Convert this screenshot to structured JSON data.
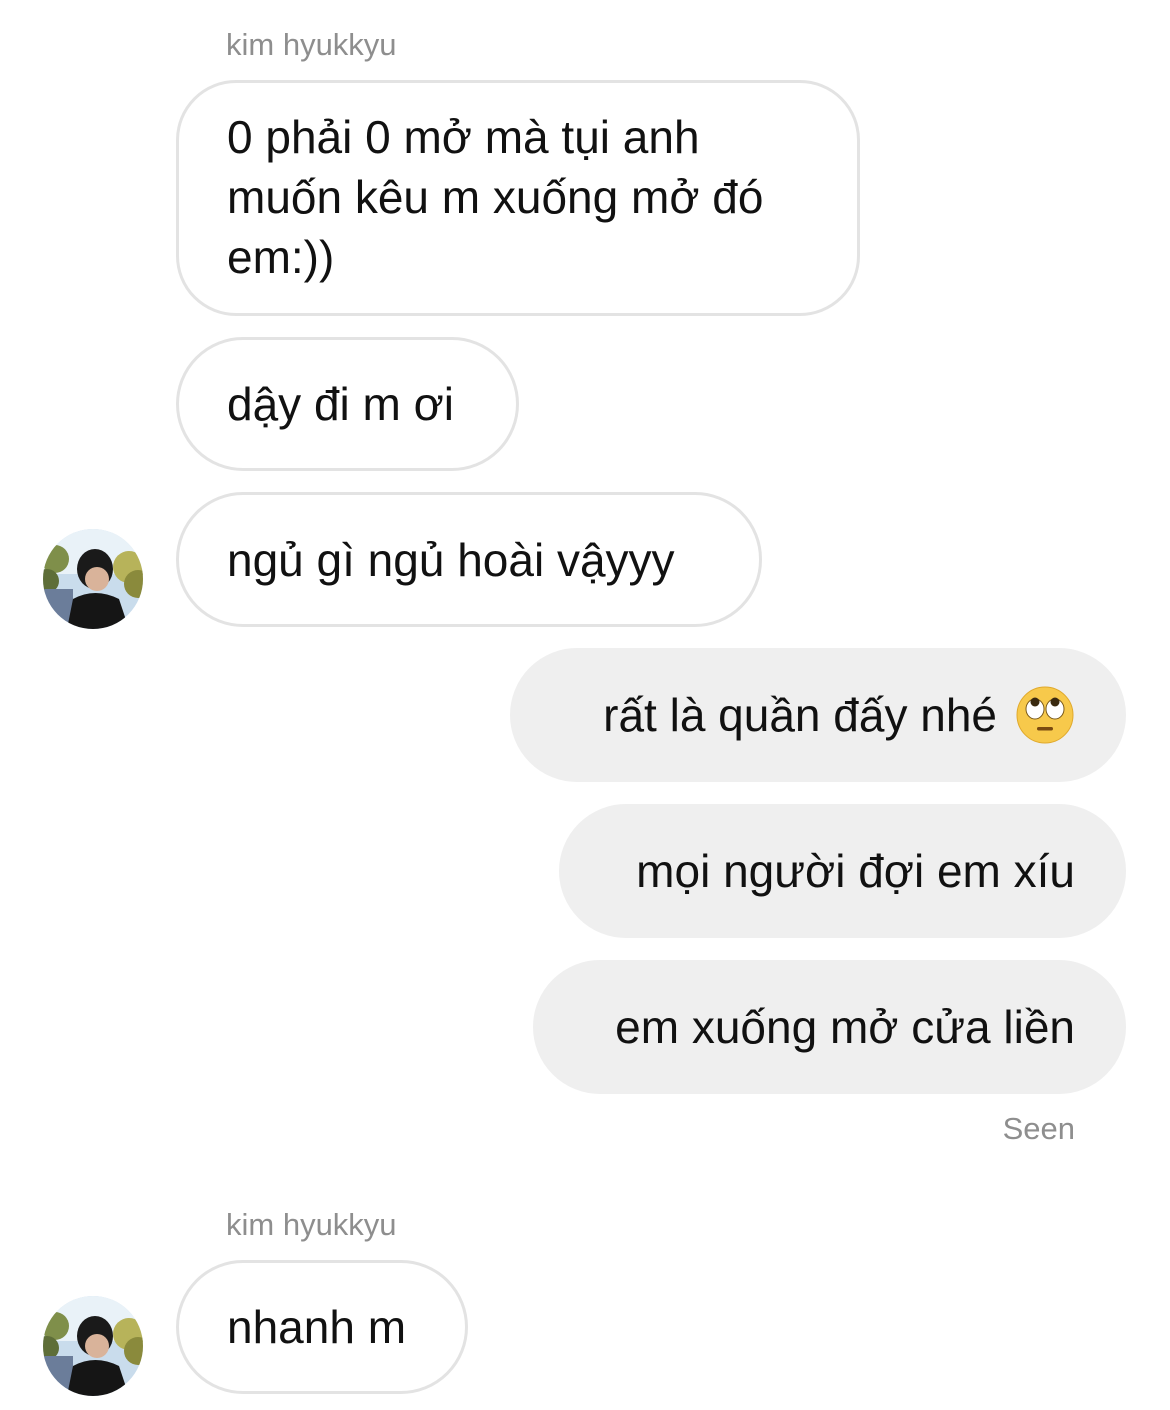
{
  "conversation": {
    "sender_name_1": "kim hyukkyu",
    "sender_name_2": "kim hyukkyu",
    "messages": [
      {
        "text_lines": [
          "0 phải 0 mở mà tụi anh",
          "muốn kêu m xuống mở đó",
          "em:))"
        ],
        "direction": "incoming"
      },
      {
        "text": "dậy đi m ơi",
        "direction": "incoming"
      },
      {
        "text": "ngủ gì ngủ hoài vậyyy",
        "direction": "incoming"
      },
      {
        "text": "rất là quần đấy nhé",
        "emoji": "face-with-rolling-eyes-icon",
        "direction": "outgoing"
      },
      {
        "text": "mọi người đợi em xíu",
        "direction": "outgoing"
      },
      {
        "text": "em xuống mở cửa liền",
        "direction": "outgoing"
      },
      {
        "text": "nhanh m",
        "direction": "incoming"
      }
    ],
    "seen_label": "Seen"
  },
  "colors": {
    "incoming_border": "#e3e3e3",
    "outgoing_bg": "#efefef",
    "meta_text": "#8e8e8e"
  }
}
